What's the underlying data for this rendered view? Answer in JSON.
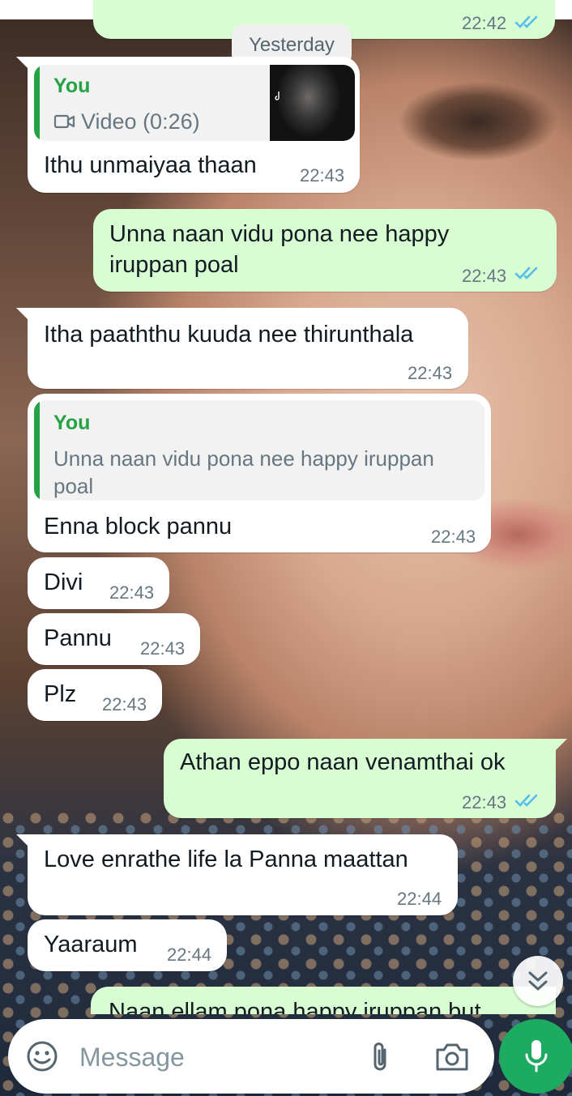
{
  "chat": {
    "date_separator": "Yesterday",
    "top_partial_time": "22:42",
    "messages": [
      {
        "id": "m1",
        "reply_author": "You",
        "reply_label": "Video (0:26)",
        "text": "Ithu unmaiyaa thaan",
        "time": "22:43"
      },
      {
        "id": "m2",
        "text_line1": "Unna naan vidu pona nee happy",
        "text_line2": "iruppan poal",
        "time": "22:43"
      },
      {
        "id": "m3",
        "text": "Itha paaththu kuuda nee thirunthala",
        "time": "22:43"
      },
      {
        "id": "m4",
        "reply_author": "You",
        "reply_line1": "Unna naan vidu pona nee happy iruppan",
        "reply_line2": "poal",
        "text": "Enna block pannu",
        "time": "22:43"
      },
      {
        "id": "m5",
        "text": "Divi",
        "time": "22:43"
      },
      {
        "id": "m6",
        "text": "Pannu",
        "time": "22:43"
      },
      {
        "id": "m7",
        "text": "Plz",
        "time": "22:43"
      },
      {
        "id": "m8",
        "text": "Athan eppo naan venamthai ok",
        "time": "22:43"
      },
      {
        "id": "m9",
        "text": "Love enrathe life la Panna maattan",
        "time": "22:44"
      },
      {
        "id": "m10",
        "text": "Yaaraum",
        "time": "22:44"
      },
      {
        "id": "m11",
        "text": "Naan ellam pona happy iruppan but"
      }
    ]
  },
  "composer": {
    "placeholder": "Message"
  },
  "colors": {
    "incoming": "#ffffff",
    "outgoing": "#d9fdd3",
    "accent_green": "#25a244",
    "read_ticks": "#53bdeb",
    "mic_button": "#1daa61"
  },
  "icons": [
    "emoji-icon",
    "attach-icon",
    "camera-icon",
    "mic-icon",
    "chevron-down-double-icon",
    "read-receipt-icon",
    "video-icon"
  ]
}
